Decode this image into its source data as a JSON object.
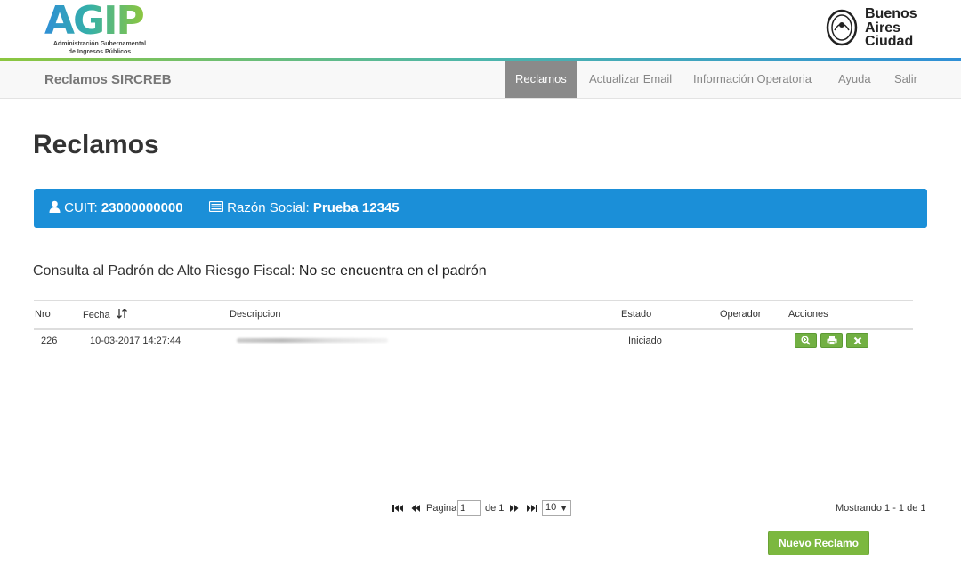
{
  "header": {
    "logo_text": "AGIP",
    "logo_subtitle_1": "Administración Gubernamental",
    "logo_subtitle_2": "de Ingresos Públicos",
    "city_logo": [
      "Buenos",
      "Aires",
      "Ciudad"
    ]
  },
  "navbar": {
    "brand": "Reclamos SIRCREB",
    "items": [
      {
        "label": "Reclamos",
        "active": true
      },
      {
        "label": "Actualizar Email",
        "active": false
      },
      {
        "label": "Información Operatoria",
        "active": false
      },
      {
        "label": "Ayuda",
        "active": false
      },
      {
        "label": "Salir",
        "active": false
      }
    ]
  },
  "page_title": "Reclamos",
  "infobar": {
    "cuit_label": "CUIT:",
    "cuit_value": "23000000000",
    "razon_label": "Razón Social:",
    "razon_value": "Prueba 12345",
    "icons": [
      "user-icon",
      "id-card-icon"
    ]
  },
  "padron": {
    "label": "Consulta al Padrón de Alto Riesgo Fiscal:",
    "value": "No se encuentra en el padrón"
  },
  "table": {
    "headers": [
      "Nro",
      "Fecha",
      "Descripcion",
      "Estado",
      "Operador",
      "Acciones"
    ],
    "rows": [
      {
        "nro": "226",
        "fecha": "10-03-2017 14:27:44",
        "descripcion": "",
        "estado": "Iniciado",
        "operador": ""
      }
    ],
    "row_actions": [
      "zoom-icon",
      "print-icon",
      "delete-icon"
    ]
  },
  "pager": {
    "page_label": "Pagina",
    "page_value": "1",
    "of_label": "de 1",
    "page_size": "10",
    "showing": "Mostrando 1 - 1 de 1"
  },
  "new_button": "Nuevo Reclamo",
  "colors": {
    "infobar": "#1b8fd8",
    "action_green": "#72b043",
    "nav_active": "#8a8a8a"
  }
}
